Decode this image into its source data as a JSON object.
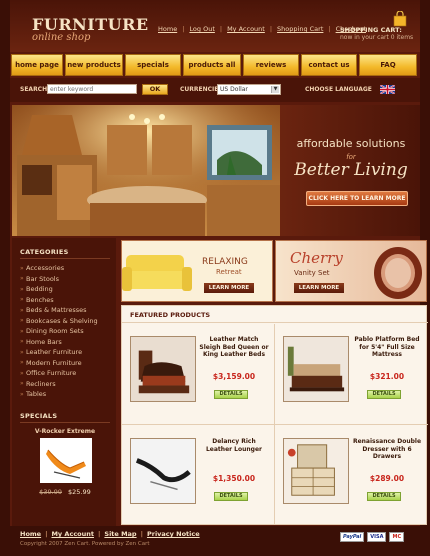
{
  "header": {
    "logo_title": "FURNITURE",
    "logo_subtitle": "online shop",
    "links": [
      "Home",
      "Log Out",
      "My Account",
      "Shopping Cart",
      "Checkout"
    ],
    "cart_title": "SHOPPING CART:",
    "cart_status": "now in your cart  0 items"
  },
  "nav": {
    "items": [
      "home page",
      "new products",
      "specials",
      "products all",
      "reviews",
      "contact us",
      "FAQ"
    ]
  },
  "searchbar": {
    "search_label": "SEARCH",
    "search_placeholder": "enter keyword",
    "ok_label": "OK",
    "currencies_label": "CURRENCIES",
    "currency_selected": "US Dollar",
    "language_label": "CHOOSE LANGUAGE"
  },
  "hero": {
    "line1": "affordable solutions",
    "line2": "for",
    "line3": "Better Living",
    "button": "CLICK HERE TO LEARN MORE"
  },
  "sidebar": {
    "categories_title": "CATEGORIES",
    "categories": [
      "Accessories",
      "Bar Stools",
      "Bedding",
      "Benches",
      "Beds & Mattresses",
      "Bookcases & Shelving",
      "Dining Room Sets",
      "Home Bars",
      "Leather Furniture",
      "Modern Furniture",
      "Office Furniture",
      "Recliners",
      "Tables"
    ],
    "specials_title": "SPECIALS",
    "special_name": "V-Rocker Extreme",
    "special_old_price": "$39.99",
    "special_new_price": "$25.99"
  },
  "banners": {
    "banner1_line1": "RELAXING",
    "banner1_line2": "Retreat",
    "banner1_button": "LEARN MORE",
    "banner2_line1": "Cherry",
    "banner2_line2": "Vanity Set",
    "banner2_button": "LEARN MORE"
  },
  "featured": {
    "title": "FEATURED PRODUCTS",
    "details_label": "DETAILS",
    "products": [
      {
        "name": "Leather Match Sleigh Bed Queen or King Leather Beds",
        "price": "$3,159.00"
      },
      {
        "name": "Pablo Platform Bed for 5'4\" Full Size Mattress",
        "price": "$321.00"
      },
      {
        "name": "Delancy Rich Leather Lounger",
        "price": "$1,350.00"
      },
      {
        "name": "Renaissance Double Dresser with 6 Drawers",
        "price": "$289.00"
      }
    ]
  },
  "footer": {
    "links": [
      "Home",
      "My Account",
      "Site Map",
      "Privacy Notice"
    ],
    "copyright": "Copyright  2007 Zen Cart. Powered by Zen Cart",
    "payments": [
      "PayPal",
      "VISA",
      "MC"
    ]
  }
}
